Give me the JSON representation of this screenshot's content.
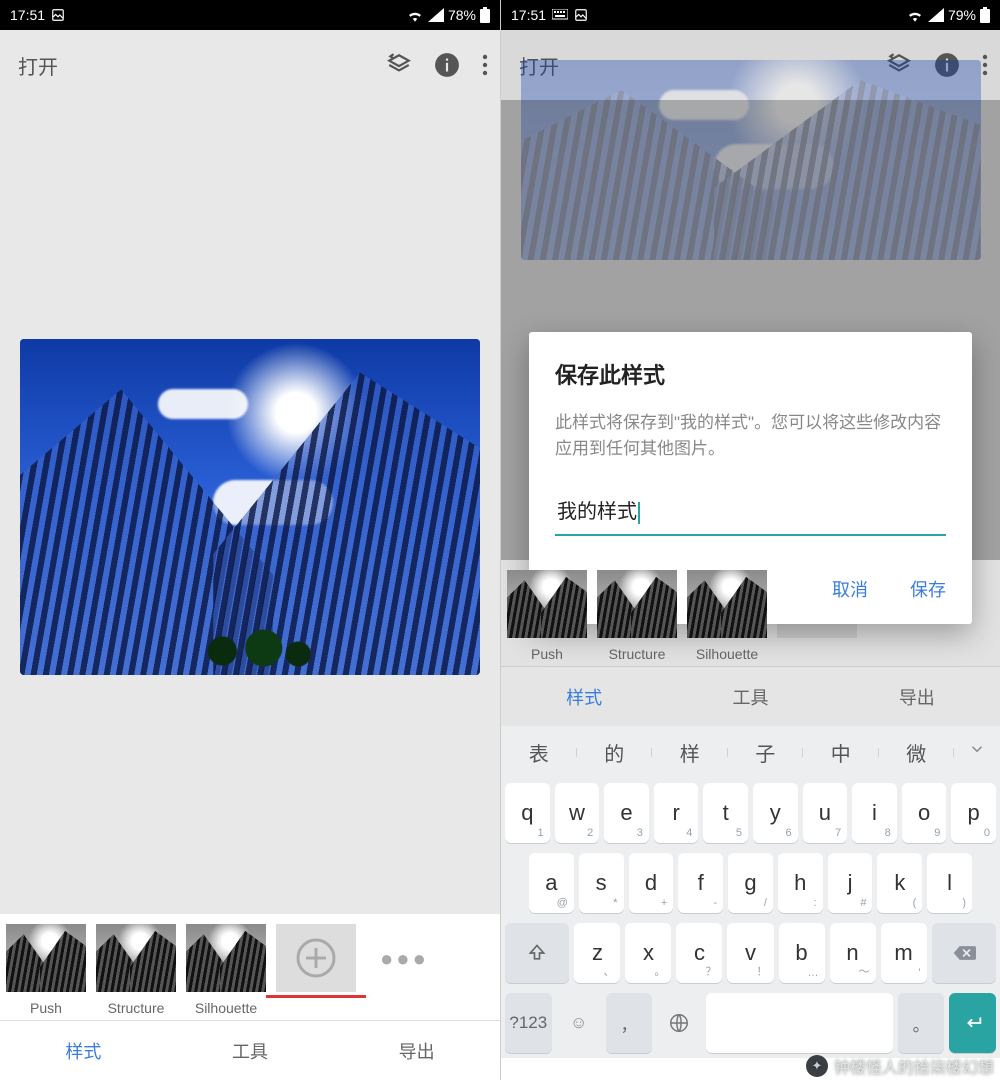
{
  "left": {
    "status": {
      "time": "17:51",
      "battery": "78%"
    },
    "header": {
      "open": "打开"
    },
    "styles": {
      "items": [
        {
          "label": "Push"
        },
        {
          "label": "Structure"
        },
        {
          "label": "Silhouette"
        }
      ]
    },
    "tabs": {
      "styles": "样式",
      "tools": "工具",
      "export": "导出",
      "active": "styles"
    }
  },
  "right": {
    "status": {
      "time": "17:51",
      "battery": "79%"
    },
    "header": {
      "open": "打开"
    },
    "dialog": {
      "title": "保存此样式",
      "body": "此样式将保存到\"我的样式\"。您可以将这些修改内容应用到任何其他图片。",
      "input_value": "我的样式",
      "cancel": "取消",
      "save": "保存"
    },
    "styles": {
      "items": [
        {
          "label": "Push"
        },
        {
          "label": "Structure"
        },
        {
          "label": "Silhouette"
        }
      ]
    },
    "tabs": {
      "styles": "样式",
      "tools": "工具",
      "export": "导出",
      "active": "styles"
    },
    "keyboard": {
      "suggestions": [
        "表",
        "的",
        "样",
        "子",
        "中",
        "微"
      ],
      "row1": [
        {
          "k": "q",
          "s": "1"
        },
        {
          "k": "w",
          "s": "2"
        },
        {
          "k": "e",
          "s": "3"
        },
        {
          "k": "r",
          "s": "4"
        },
        {
          "k": "t",
          "s": "5"
        },
        {
          "k": "y",
          "s": "6"
        },
        {
          "k": "u",
          "s": "7"
        },
        {
          "k": "i",
          "s": "8"
        },
        {
          "k": "o",
          "s": "9"
        },
        {
          "k": "p",
          "s": "0"
        }
      ],
      "row2": [
        {
          "k": "a",
          "s": "@"
        },
        {
          "k": "s",
          "s": "*"
        },
        {
          "k": "d",
          "s": "+"
        },
        {
          "k": "f",
          "s": "-"
        },
        {
          "k": "g",
          "s": "/"
        },
        {
          "k": "h",
          "s": ":"
        },
        {
          "k": "j",
          "s": "#"
        },
        {
          "k": "k",
          "s": "("
        },
        {
          "k": "l",
          "s": ")"
        }
      ],
      "row3": [
        {
          "k": "z",
          "s": "、"
        },
        {
          "k": "x",
          "s": "。"
        },
        {
          "k": "c",
          "s": "？"
        },
        {
          "k": "v",
          "s": "！"
        },
        {
          "k": "b",
          "s": "…"
        },
        {
          "k": "n",
          "s": "～"
        },
        {
          "k": "m",
          "s": "'"
        }
      ],
      "fn": {
        "symbols": "?123",
        "comma": "，",
        "period": "。"
      }
    }
  },
  "watermark": "钟楼怪人的拾柒楼幻想"
}
